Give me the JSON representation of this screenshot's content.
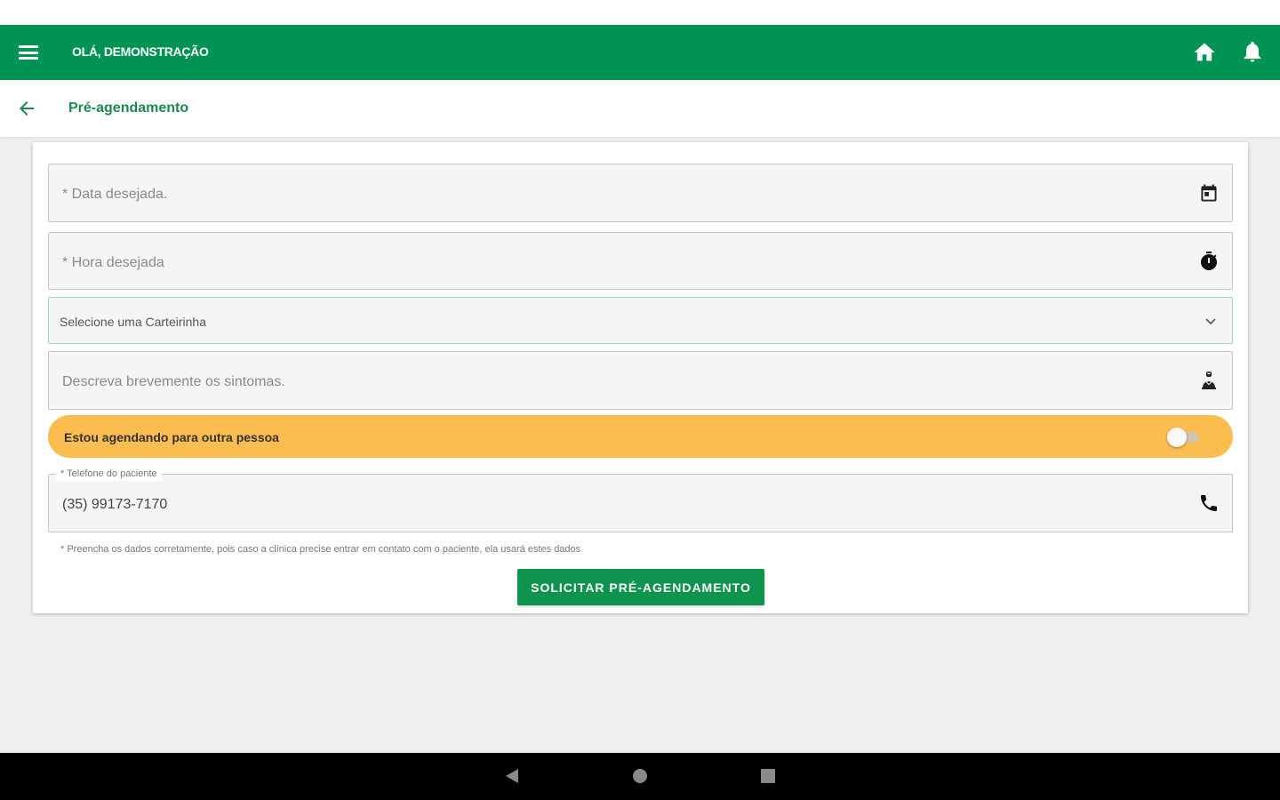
{
  "header": {
    "greeting": "OLÁ, DEMONSTRAÇÃO",
    "menu_icon": "menu-icon",
    "home_icon": "home-icon",
    "notifications_icon": "bell-icon",
    "color": "#009353"
  },
  "subheader": {
    "title": "Pré-agendamento",
    "back_icon": "arrow-left-icon",
    "title_color": "#1a8a4e"
  },
  "form": {
    "date": {
      "placeholder": "* Data desejada.",
      "icon": "calendar-icon"
    },
    "time": {
      "placeholder": "* Hora desejada",
      "icon": "stopwatch-icon"
    },
    "card_select": {
      "selected": "Selecione uma Carteirinha",
      "icon": "chevron-down-icon"
    },
    "symptoms": {
      "placeholder": "Descreva brevemente os sintomas.",
      "icon": "patient-icon"
    },
    "other_person": {
      "label": "Estou agendando para outra pessoa",
      "checked": false,
      "bg_color": "#fbbd4f"
    },
    "phone": {
      "label": "* Telefone do paciente",
      "value": "(35) 99173-7170",
      "icon": "phone-icon"
    },
    "hint": "* Preencha os dados corretamente, pois caso a clínica precise entrar em contato com o paciente, ela usará estes dados",
    "submit_label": "SOLICITAR PRÉ-AGENDAMENTO",
    "submit_color": "#0e944f"
  },
  "system_nav": {
    "back_icon": "nav-back-icon",
    "home_icon": "nav-home-icon",
    "recent_icon": "nav-recent-icon"
  }
}
